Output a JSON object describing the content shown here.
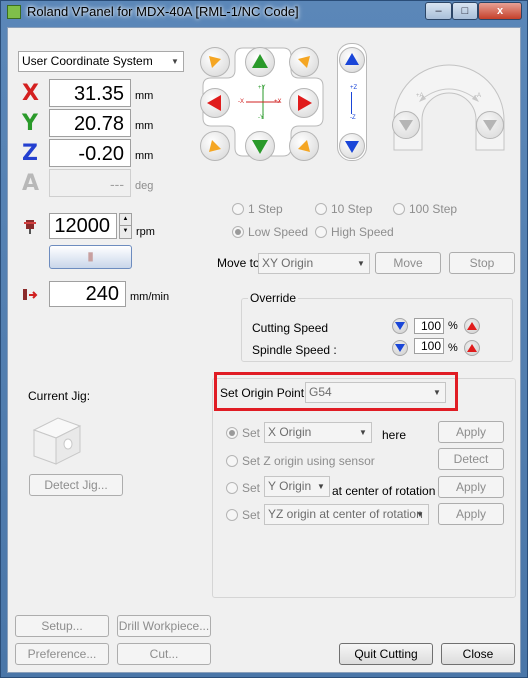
{
  "window": {
    "title": "Roland VPanel for MDX-40A [RML-1/NC Code]",
    "controls": {
      "minimize": "–",
      "maximize": "□",
      "close": "x"
    }
  },
  "coordinate_system": {
    "selected": "User Coordinate System"
  },
  "axes": [
    {
      "letter": "X",
      "value": "31.35",
      "unit": "mm",
      "color": "#d42020"
    },
    {
      "letter": "Y",
      "value": "20.78",
      "unit": "mm",
      "color": "#2a9a2a"
    },
    {
      "letter": "Z",
      "value": "-0.20",
      "unit": "mm",
      "color": "#2440d0"
    },
    {
      "letter": "A",
      "value": "---",
      "unit": "deg",
      "color": "#b8b8b8"
    }
  ],
  "spindle": {
    "value": "12000",
    "unit": "rpm"
  },
  "feed": {
    "value": "240",
    "unit": "mm/min"
  },
  "jog_labels": {
    "plus_y": "+Y",
    "minus_y": "-Y",
    "minus_x": "-X",
    "plus_x": "+X",
    "plus_z": "+Z",
    "minus_z": "-Z",
    "rot_left": "+A",
    "rot_right": "-A"
  },
  "step": {
    "options": [
      "1 Step",
      "10 Step",
      "100 Step"
    ],
    "speed_options": [
      "Low Speed",
      "High Speed"
    ],
    "speed_selected": "Low Speed"
  },
  "move_to": {
    "label": "Move to",
    "selected": "XY Origin",
    "move_button": "Move",
    "stop_button": "Stop"
  },
  "override": {
    "title": "Override",
    "cutting_label": "Cutting Speed",
    "cutting_value": "100",
    "spindle_label": "Spindle Speed :",
    "spindle_value": "100",
    "percent": "%"
  },
  "current_jig": {
    "label": "Current Jig:",
    "detect_button": "Detect Jig..."
  },
  "origin": {
    "label": "Set Origin Point",
    "selected": "G54",
    "rows": [
      {
        "set_label": "Set",
        "select": "X Origin",
        "suffix": "here",
        "button": "Apply"
      },
      {
        "set_label": "Set Z origin using sensor",
        "button": "Detect"
      },
      {
        "set_label": "Set",
        "select": "Y Origin",
        "suffix": "at center of rotation",
        "button": "Apply"
      },
      {
        "set_label": "Set",
        "select": "YZ origin at center of rotation",
        "button": "Apply"
      }
    ]
  },
  "bottom_buttons": {
    "setup": "Setup...",
    "drill": "Drill Workpiece...",
    "preference": "Preference...",
    "cut": "Cut...",
    "quit_cutting": "Quit Cutting",
    "close": "Close"
  },
  "colors": {
    "highlight_box": "#e01c24",
    "jog_green": "#2a9a2a",
    "jog_red": "#e01c1c",
    "jog_orange": "#f5a623",
    "jog_blue": "#1a46d8"
  }
}
